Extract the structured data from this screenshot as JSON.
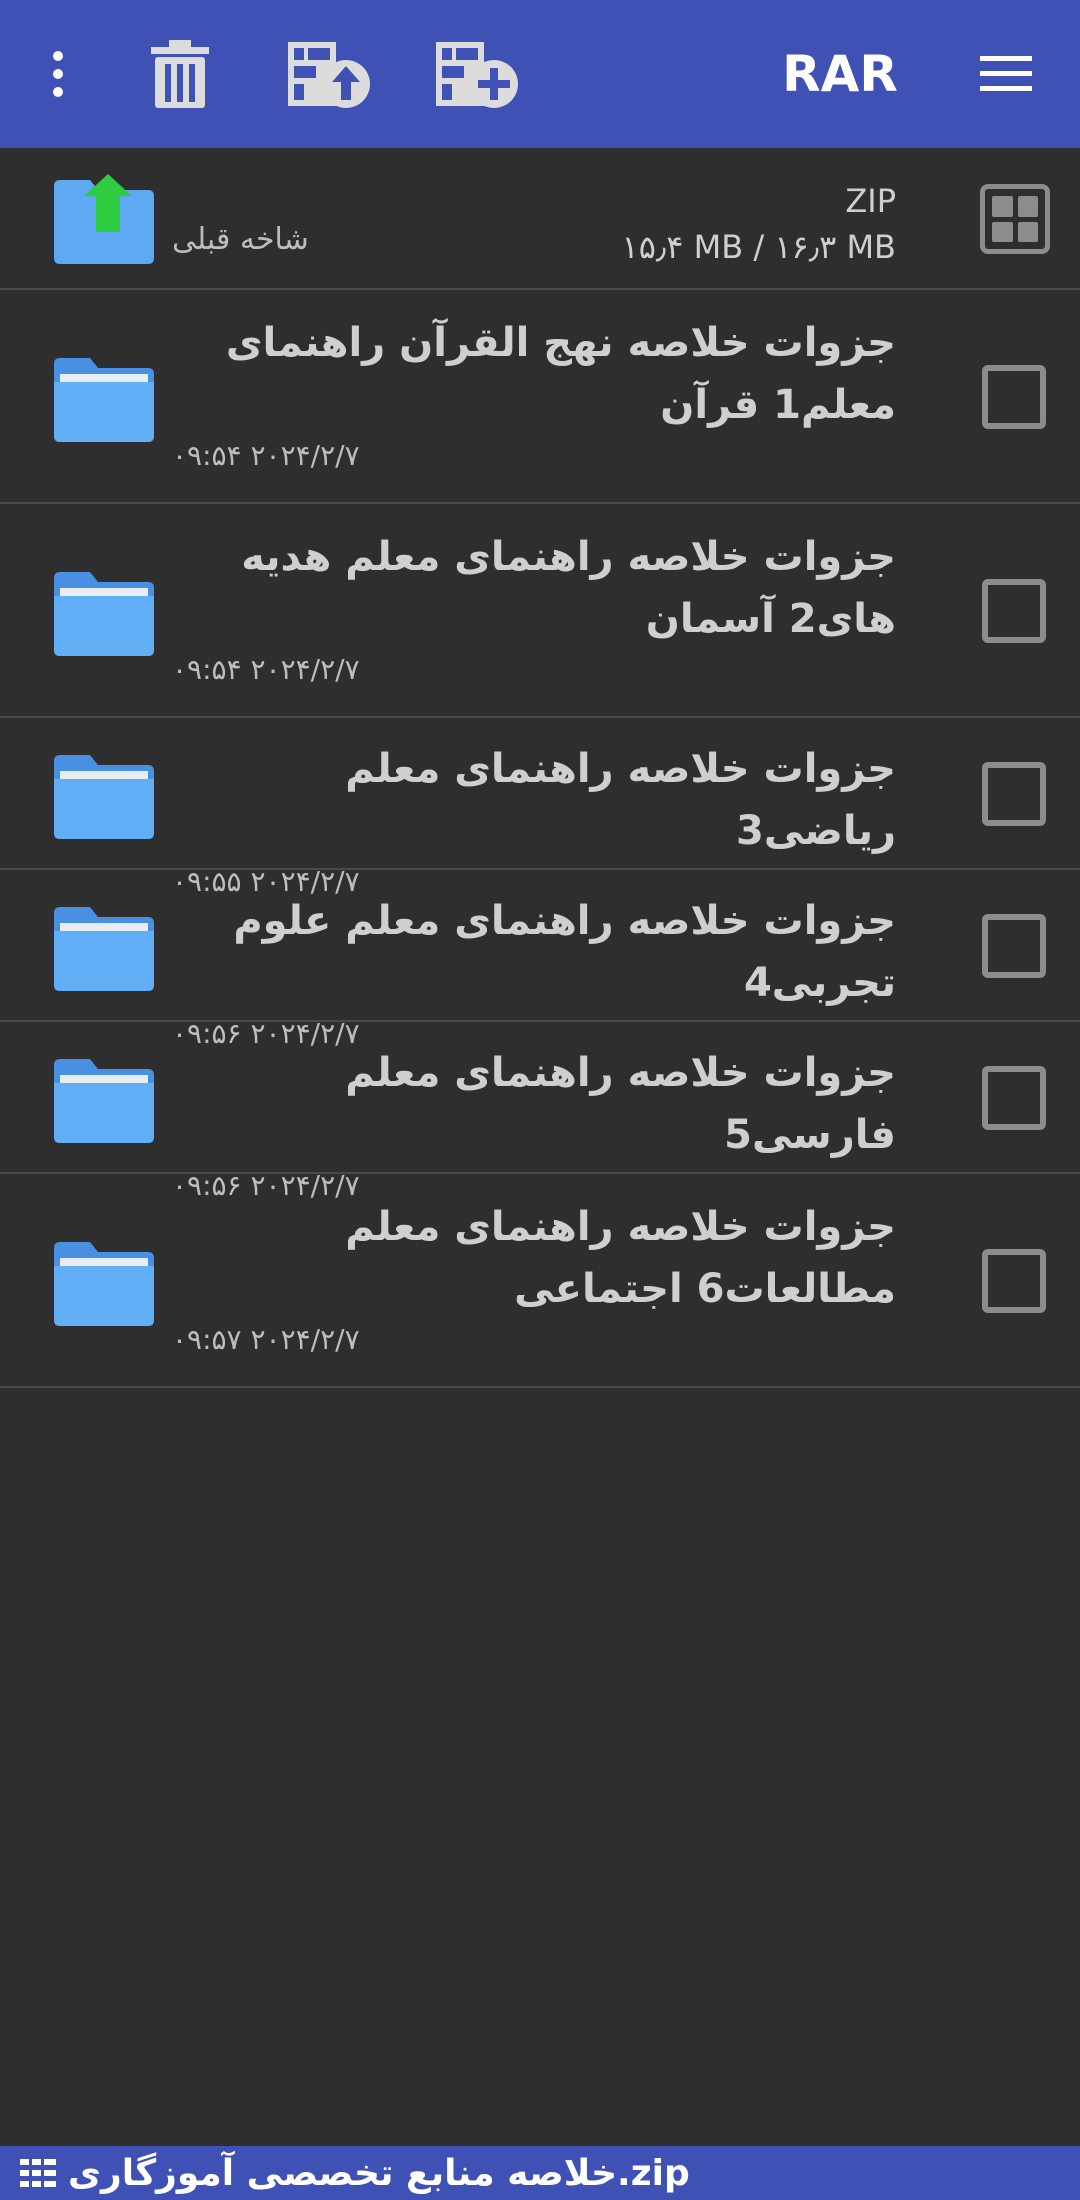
{
  "toolbar": {
    "title": "RAR",
    "more_icon": "more-vertical-icon",
    "trash_icon": "trash-icon",
    "extract_icon": "archive-extract-icon",
    "add_icon": "archive-add-icon",
    "menu_icon": "hamburger-menu-icon",
    "color": "#3f51b5"
  },
  "parent": {
    "label": "شاخه قبلی",
    "archive_type": "ZIP",
    "size_text": "۱۵٫۴ MB / ۱۶٫۳ MB"
  },
  "items": [
    {
      "name": "جزوات خلاصه نهج القرآن راهنمای معلم1 قرآن",
      "date": "۲۰۲۴/۲/۷ ۰۹:۵۴"
    },
    {
      "name": "جزوات خلاصه راهنمای معلم هدیه های2 آسمان",
      "date": "۲۰۲۴/۲/۷ ۰۹:۵۴"
    },
    {
      "name": "جزوات خلاصه راهنمای معلم ریاضی3",
      "date": "۲۰۲۴/۲/۷ ۰۹:۵۵"
    },
    {
      "name": "جزوات خلاصه راهنمای معلم علوم تجربی4",
      "date": "۲۰۲۴/۲/۷ ۰۹:۵۶"
    },
    {
      "name": "جزوات خلاصه راهنمای معلم فارسی5",
      "date": "۲۰۲۴/۲/۷ ۰۹:۵۶"
    },
    {
      "name": "جزوات خلاصه راهنمای معلم مطالعات6 اجتماعی",
      "date": "۲۰۲۴/۲/۷ ۰۹:۵۷"
    }
  ],
  "bottom": {
    "archive_name": "خلاصه منابع تخصصی آموزگاری.zip"
  }
}
